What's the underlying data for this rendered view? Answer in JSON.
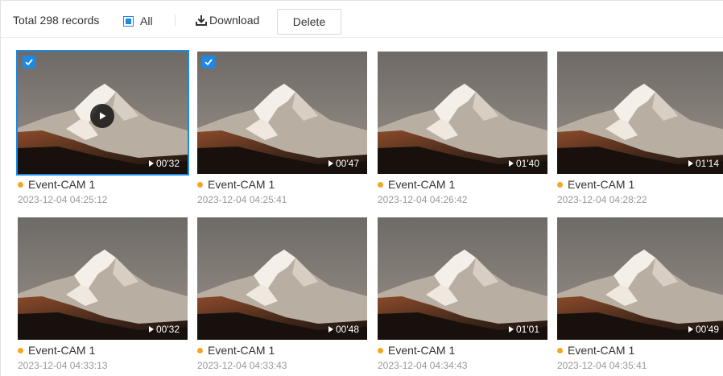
{
  "toolbar": {
    "total_text": "Total 298 records",
    "all_label": "All",
    "download_label": "Download",
    "delete_label": "Delete"
  },
  "colors": {
    "accent": "#1e88e5",
    "event_dot": "#f5a623"
  },
  "records": [
    {
      "camera": "Event-CAM 1",
      "time": "2023-12-04 04:25:12",
      "duration": "00'32",
      "checked": true,
      "active": true
    },
    {
      "camera": "Event-CAM 1",
      "time": "2023-12-04 04:25:41",
      "duration": "00'47",
      "checked": true,
      "active": false
    },
    {
      "camera": "Event-CAM 1",
      "time": "2023-12-04 04:26:42",
      "duration": "01'40",
      "checked": false,
      "active": false
    },
    {
      "camera": "Event-CAM 1",
      "time": "2023-12-04 04:28:22",
      "duration": "01'14",
      "checked": false,
      "active": false
    },
    {
      "camera": "Event-CAM 1",
      "time": "2023-12-04 04:33:13",
      "duration": "00'32",
      "checked": false,
      "active": false
    },
    {
      "camera": "Event-CAM 1",
      "time": "2023-12-04 04:33:43",
      "duration": "00'48",
      "checked": false,
      "active": false
    },
    {
      "camera": "Event-CAM 1",
      "time": "2023-12-04 04:34:43",
      "duration": "01'01",
      "checked": false,
      "active": false
    },
    {
      "camera": "Event-CAM 1",
      "time": "2023-12-04 04:35:41",
      "duration": "00'49",
      "checked": false,
      "active": false
    }
  ]
}
